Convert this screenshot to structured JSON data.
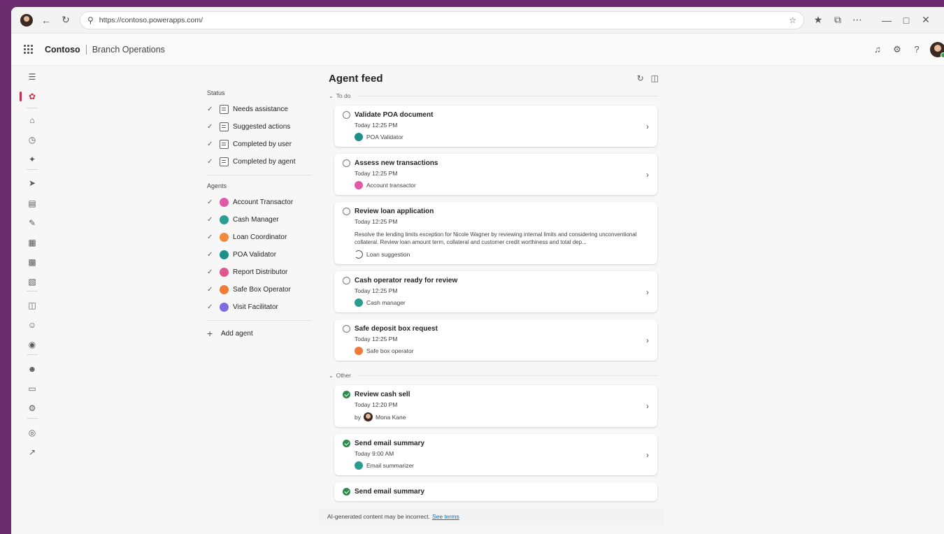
{
  "browser": {
    "url": "https://contoso.powerapps.com/"
  },
  "app": {
    "brand": "Contoso",
    "name": "Branch Operations"
  },
  "filters": {
    "status_heading": "Status",
    "status": [
      {
        "label": "Needs assistance"
      },
      {
        "label": "Suggested actions"
      },
      {
        "label": "Completed by user"
      },
      {
        "label": "Completed by agent"
      }
    ],
    "agents_heading": "Agents",
    "agents": [
      {
        "label": "Account Transactor",
        "color": "#e05aa5"
      },
      {
        "label": "Cash Manager",
        "color": "#2a9d8f"
      },
      {
        "label": "Loan Coordinator",
        "color": "#f08a3c"
      },
      {
        "label": "POA Validator",
        "color": "#1f8f8a"
      },
      {
        "label": "Report Distributor",
        "color": "#e0568f"
      },
      {
        "label": "Safe Box Operator",
        "color": "#f07c3a"
      },
      {
        "label": "Visit Facilitator",
        "color": "#7a6ee0"
      }
    ],
    "add_agent": "Add agent"
  },
  "feed": {
    "title": "Agent feed",
    "todo_label": "To do",
    "other_label": "Other",
    "todo": [
      {
        "title": "Validate POA document",
        "time": "Today 12:25 PM",
        "agent": "POA Validator",
        "color": "#1f8f8a"
      },
      {
        "title": "Assess new transactions",
        "time": "Today 12:25 PM",
        "agent": "Account transactor",
        "color": "#e05aa5"
      },
      {
        "title": "Review loan application",
        "time": "Today 12:25 PM",
        "desc": "Resolve the lending limits exception for Nicole Wagner by reviewing internal limits and considering unconventional collateral. Review loan amount term, collateral and customer credit worthiness and total dep...",
        "agent": "Loan suggestion"
      },
      {
        "title": "Cash operator ready for review",
        "time": "Today 12:25 PM",
        "agent": "Cash manager",
        "color": "#2a9d8f"
      },
      {
        "title": "Safe deposit box request",
        "time": "Today 12:25 PM",
        "agent": "Safe box operator",
        "color": "#f07c3a"
      }
    ],
    "other": [
      {
        "title": "Review cash sell",
        "time": "Today 12:20 PM",
        "by": "by",
        "agent": "Mona Kane"
      },
      {
        "title": "Send email summary",
        "time": "Today 9:00 AM",
        "agent": "Email summarizer",
        "color": "#2a9d8f"
      },
      {
        "title": "Send email summary"
      }
    ]
  },
  "footer": {
    "text": "AI-generated content may be incorrect.",
    "link": "See terms"
  }
}
